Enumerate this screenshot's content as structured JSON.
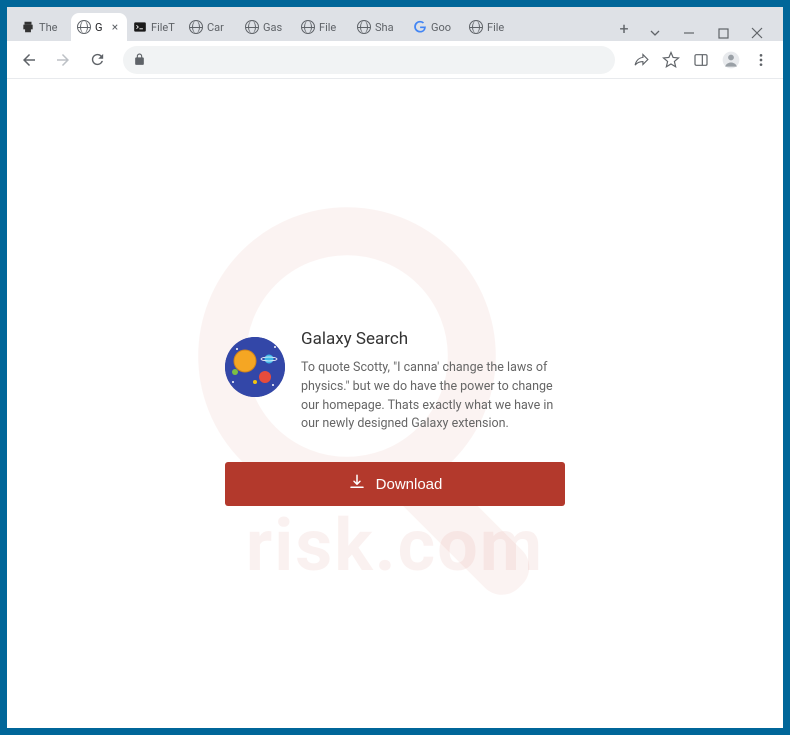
{
  "window": {
    "tabs": [
      {
        "label": "The",
        "icon": "printer"
      },
      {
        "label": "G",
        "icon": "globe",
        "active": true
      },
      {
        "label": "FileT",
        "icon": "terminal"
      },
      {
        "label": "Car",
        "icon": "globe"
      },
      {
        "label": "Gas",
        "icon": "globe"
      },
      {
        "label": "File",
        "icon": "globe"
      },
      {
        "label": "Sha",
        "icon": "globe"
      },
      {
        "label": "Goo",
        "icon": "google"
      },
      {
        "label": "File",
        "icon": "globe"
      }
    ]
  },
  "page": {
    "title": "Galaxy Search",
    "description": "To quote Scotty, \"I canna' change the laws of physics.\" but we do have the power to change our homepage. Thats exactly what we have in our newly designed Galaxy extension.",
    "download_label": "Download"
  },
  "watermark": {
    "text": "risk.com"
  },
  "colors": {
    "download_bg": "#b3392c",
    "frame": "#006699"
  }
}
